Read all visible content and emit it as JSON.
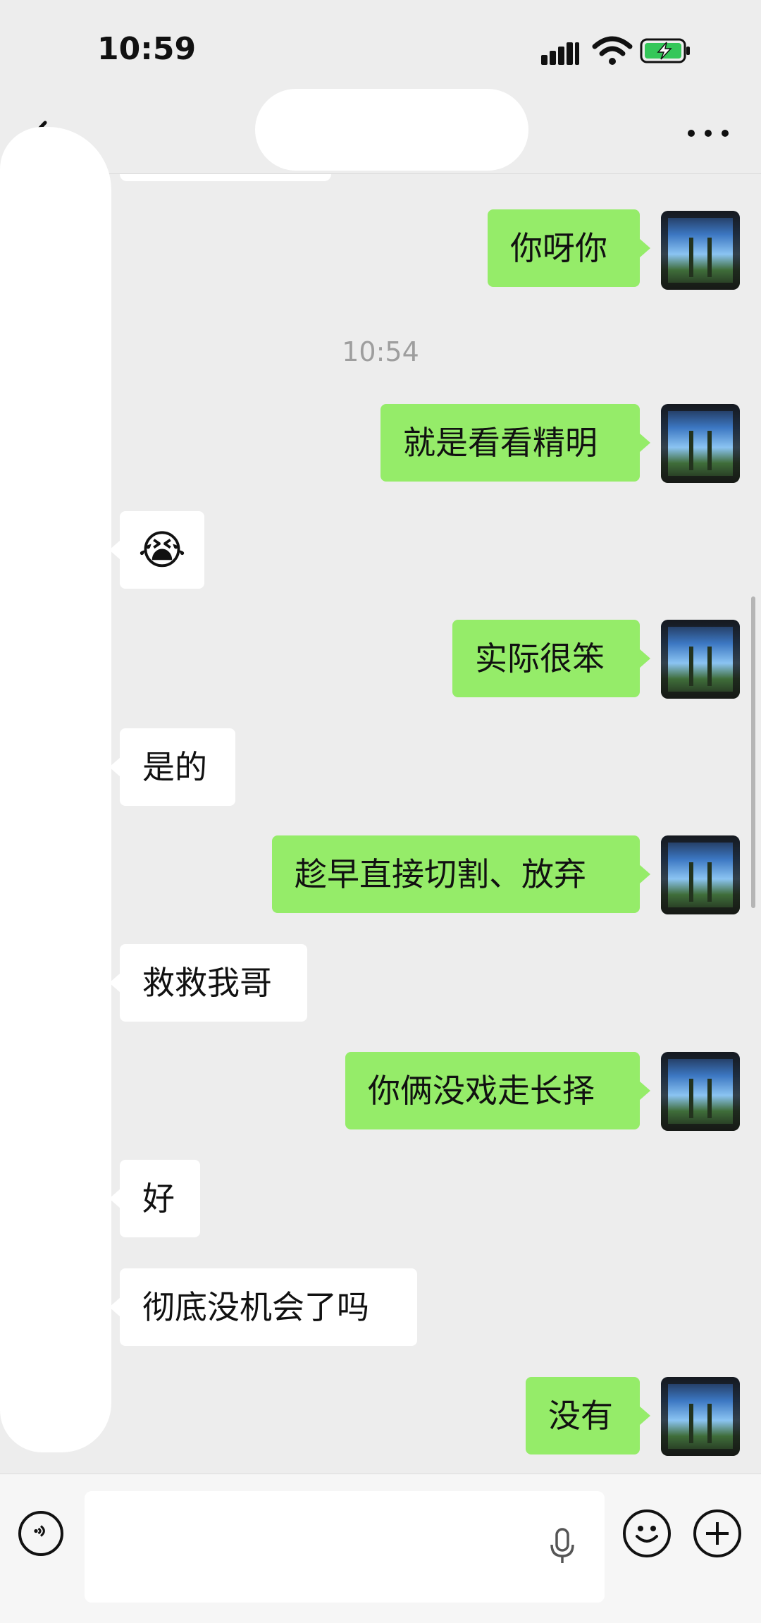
{
  "status_bar": {
    "time": "10:59"
  },
  "chat": {
    "messages": [
      {
        "side": "me",
        "text": "你呀你"
      },
      {
        "side": "time",
        "text": "10:54"
      },
      {
        "side": "me",
        "text": "就是看看精明"
      },
      {
        "side": "them",
        "text": "😭"
      },
      {
        "side": "me",
        "text": "实际很笨"
      },
      {
        "side": "them",
        "text": "是的"
      },
      {
        "side": "me",
        "text": "趁早直接切割、放弃"
      },
      {
        "side": "them",
        "text": "救救我哥"
      },
      {
        "side": "me",
        "text": "你俩没戏走长择"
      },
      {
        "side": "them",
        "text": "好"
      },
      {
        "side": "them",
        "text": "彻底没机会了吗"
      },
      {
        "side": "me",
        "text": "没有"
      }
    ]
  },
  "colors": {
    "sent_bubble": "#95ec69",
    "received_bubble": "#ffffff",
    "background": "#ededed"
  },
  "icons": [
    "back-arrow-icon",
    "more-dots-icon",
    "voice-icon",
    "microphone-icon",
    "emoji-icon",
    "plus-icon",
    "signal-icon",
    "wifi-icon",
    "battery-charging-icon"
  ]
}
